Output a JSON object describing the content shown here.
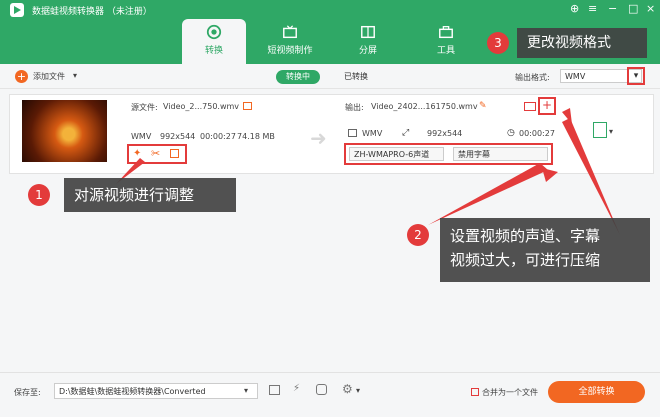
{
  "app": {
    "title": "数据蛙视频转换器 （未注册）"
  },
  "tabs": [
    {
      "label": "转换",
      "active": true
    },
    {
      "label": "短视频制作"
    },
    {
      "label": "分屏"
    },
    {
      "label": "工具"
    }
  ],
  "toolbar": {
    "add_file": "添加文件",
    "converting": "转换中",
    "converted": "已转换",
    "output_format_label": "输出格式:",
    "output_format_value": "WMV"
  },
  "file": {
    "source_label": "源文件:",
    "source_name": "Video_2...750.wmv",
    "format": "WMV",
    "resolution": "992x544",
    "duration": "00:00:27",
    "size": "74.18 MB",
    "output_label": "输出:",
    "output_name": "Video_2402...161750.wmv",
    "out_format": "WMV",
    "out_resolution": "992x544",
    "out_duration": "00:00:27",
    "audio_track": "ZH-WMAPRO-6声道",
    "subtitle": "禁用字幕"
  },
  "annotations": [
    {
      "num": "1",
      "text": "对源视频进行调整"
    },
    {
      "num": "2",
      "text_line1": "设置视频的声道、字幕",
      "text_line2": "视频过大，可进行压缩"
    },
    {
      "num": "3",
      "text": "更改视频格式"
    }
  ],
  "bottom": {
    "save_to_label": "保存至:",
    "save_path": "D:\\数据蛙\\数据蛙视频转换器\\Converted",
    "merge_label": "合并为一个文件",
    "convert_all": "全部转换"
  },
  "colors": {
    "brand": "#2fa866",
    "accent": "#f26722",
    "annotation": "#e33b3b"
  }
}
